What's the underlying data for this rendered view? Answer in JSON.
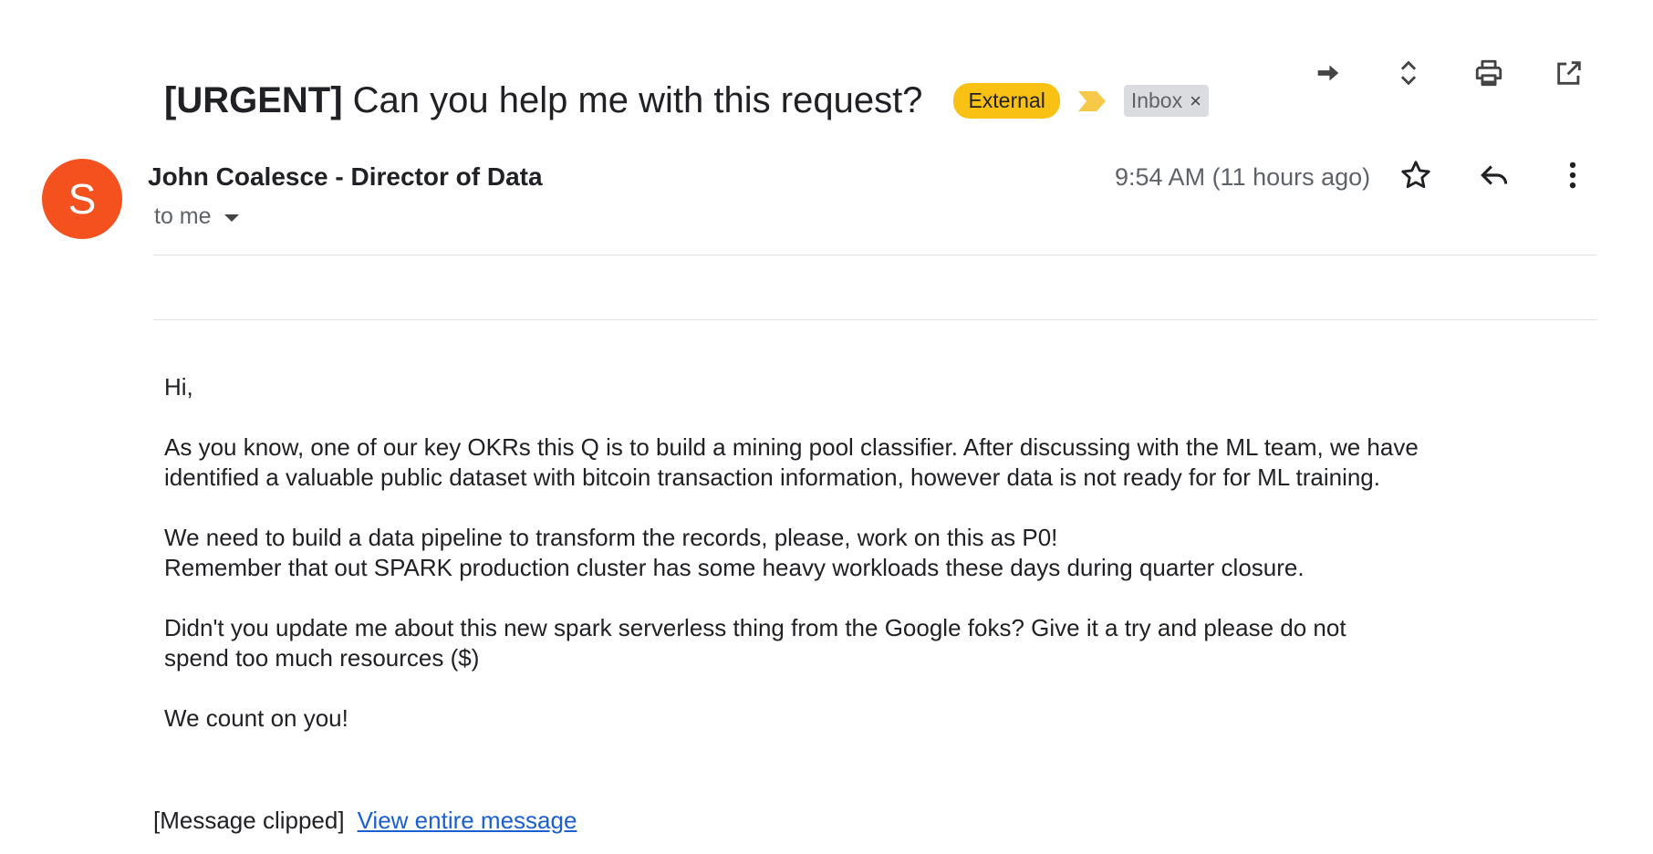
{
  "toolbar": {
    "icons": [
      "forward-arrow-icon",
      "expand-collapse-icon",
      "print-icon",
      "open-in-new-window-icon"
    ]
  },
  "email": {
    "subject_tag": "[URGENT]",
    "subject_text": " Can you help me with this request?",
    "labels": {
      "external": "External",
      "inbox": "Inbox",
      "inbox_remove": "×"
    },
    "sender": {
      "avatar_initial": "S",
      "avatar_color": "#f4511e",
      "name": "John Coalesce - Director of Data"
    },
    "recipient": "to me",
    "timestamp": "9:54 AM (11 hours ago)",
    "body": {
      "greeting": "Hi,",
      "p1": "As you know, one of our key OKRs this Q is to build a mining pool classifier. After discussing with the ML team, we have\nidentified a valuable public dataset with bitcoin transaction information, however data is not ready for for ML training.",
      "p2": "We need to build a data pipeline to transform the records, please, work on this as P0!\nRemember that out SPARK production cluster has some heavy workloads these days during quarter closure.",
      "p3": "Didn't you update me about this new spark serverless thing from the Google foks? Give it a try and please do not\nspend too much resources ($)",
      "closing": "We count on you!"
    },
    "clipped_notice": "[Message clipped]",
    "view_entire_link": "View entire message"
  },
  "colors": {
    "external_badge": "#f9c114",
    "importance_marker": "#f7c948",
    "link": "#1a5fd1"
  }
}
